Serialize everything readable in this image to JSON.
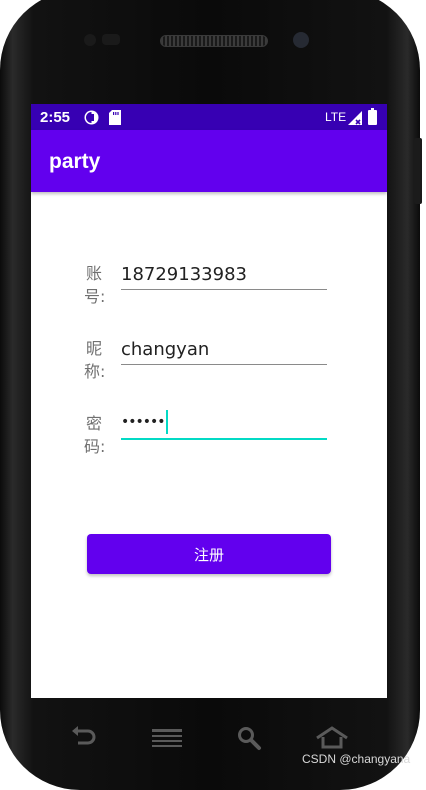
{
  "status_bar": {
    "time": "2:55",
    "network": "LTE",
    "icons": [
      "sync-icon",
      "sd-card-icon",
      "signal-icon",
      "battery-icon"
    ]
  },
  "app_bar": {
    "title": "party"
  },
  "form": {
    "account": {
      "label": "账号:",
      "value": "18729133983"
    },
    "nickname": {
      "label": "昵称:",
      "value": "changyan"
    },
    "password": {
      "label": "密码:",
      "masked_value": "••••••"
    },
    "register_label": "注册"
  },
  "nav_bar": {
    "icons": [
      "back-icon",
      "menu-icon",
      "search-icon",
      "home-icon"
    ]
  },
  "watermark": "CSDN @changyana",
  "colors": {
    "primary": "#6200ee",
    "primary_dark": "#3700b3",
    "accent": "#03dac5"
  }
}
